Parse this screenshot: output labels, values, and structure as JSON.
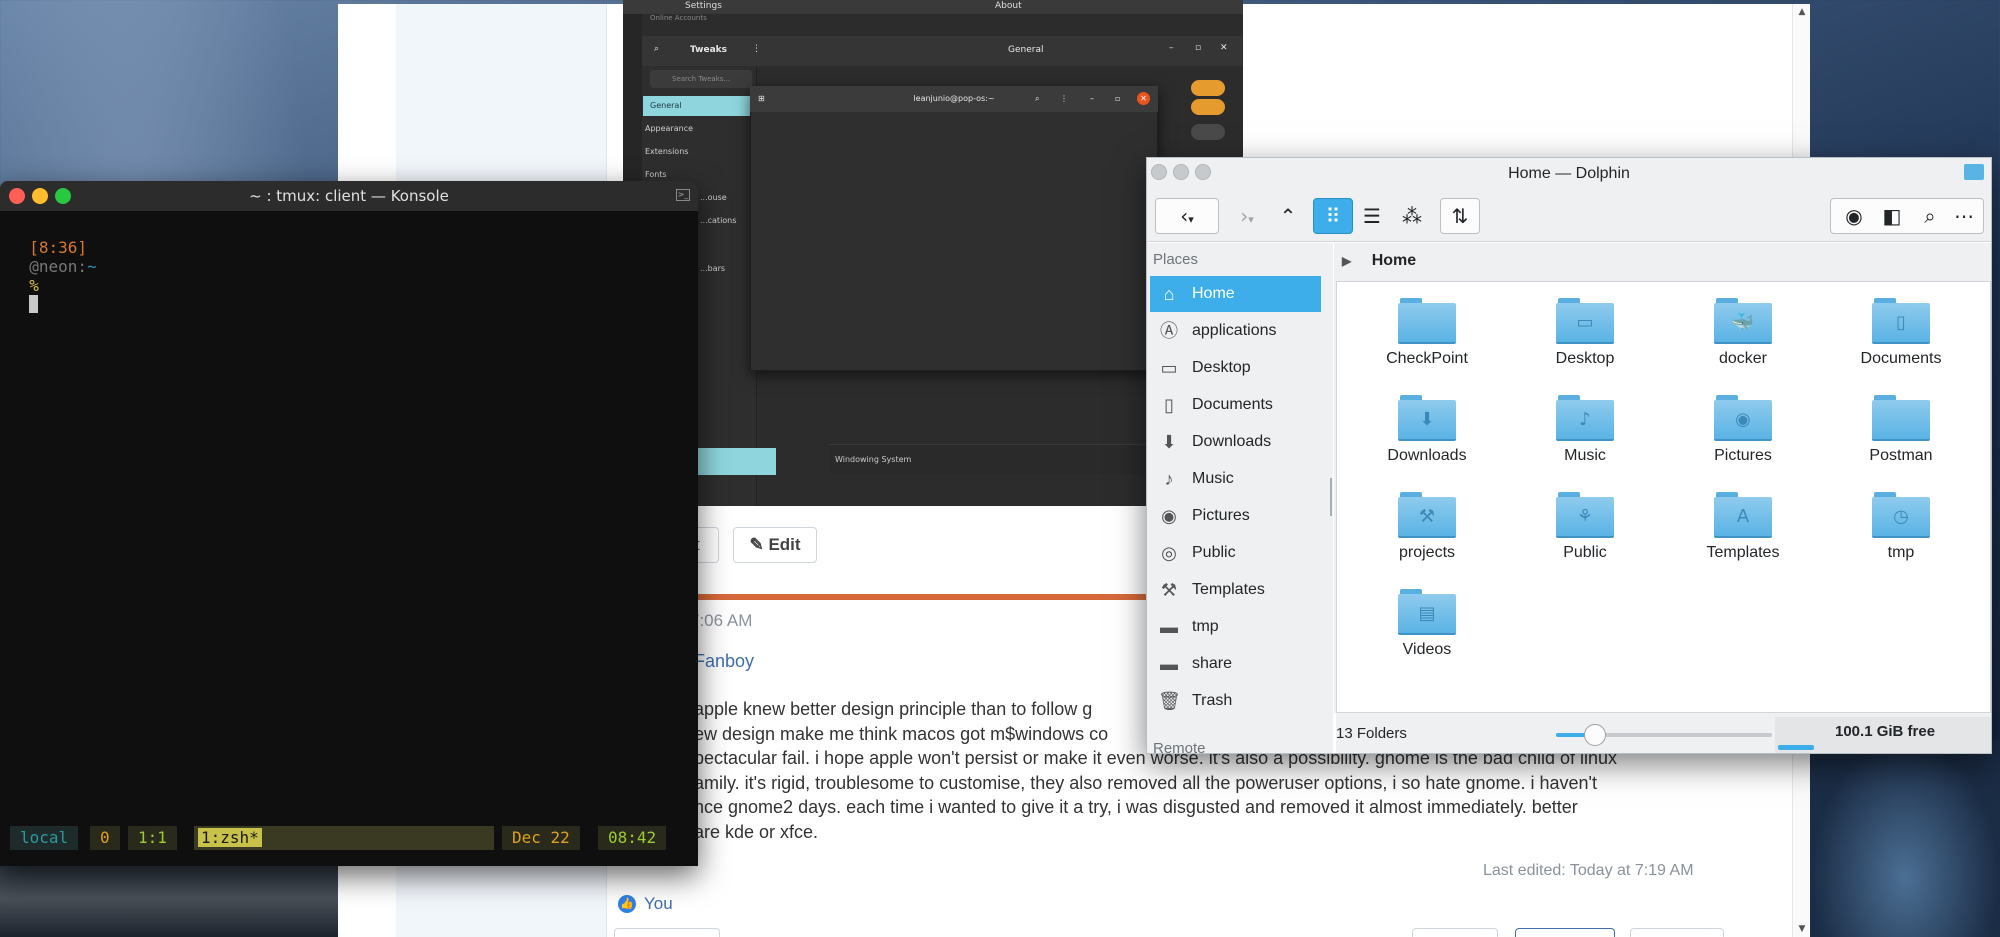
{
  "browser": {
    "post_button_fragment": "t",
    "edit_label": "Edit",
    "edit_icon": "pencil-icon",
    "post_time": "7:06 AM",
    "post_author": "Fanboy",
    "post_lines": [
      "apple knew better design principle than to follow g",
      "ew design make me think macos got m$windows co",
      "pectacular fail. i hope apple won't persist or make it even worse. it's also a possibility. gnome is the bad child of linux",
      "amily. it's rigid, troublesome to customise, they also removed all the poweruser options, i so hate gnome. i haven't",
      "nce gnome2 days. each time i wanted to give it a try, i was disgusted and removed it almost immediately. better",
      "are kde or xfce."
    ],
    "last_edited": "Last edited: Today at 7:19 AM",
    "like_label": "You",
    "like_icon": "thumbs-up-icon"
  },
  "gnome": {
    "settings_title": "Settings",
    "about_title": "About",
    "tweaks_title": "Tweaks",
    "general_title": "General",
    "search_placeholder": "Search Tweaks...",
    "partial_item": "Online Accounts",
    "sidebar_items": [
      "General",
      "Appearance",
      "Extensions",
      "Fonts",
      "...ouse",
      "...cations",
      "...bars"
    ],
    "terminal_title": "leanjunio@pop-os:~",
    "windowing_system": "Windowing System"
  },
  "konsole": {
    "title": "~ : tmux: client — Konsole",
    "prompt_time": "[8:36]",
    "prompt_host": "@neon:",
    "prompt_path": "~",
    "prompt_symbol": "%",
    "status": {
      "session": "local",
      "index": "0",
      "pane": "1:1",
      "window": "1:zsh*",
      "date": "Dec 22",
      "time": "08:42"
    },
    "colors": {
      "time": "#d9782b",
      "host": "#777777",
      "path": "#2b8fb5",
      "symbol": "#e0c050",
      "status_session": "#2a9aa0",
      "status_green": "#9acd32",
      "status_date": "#e0a020"
    }
  },
  "dolphin": {
    "title": "Home — Dolphin",
    "toolbar": {
      "back_icon": "back-arrow-icon",
      "forward_icon": "forward-arrow-icon",
      "up_icon": "up-arrow-icon",
      "icons_view": "icons-view-icon",
      "details_view": "details-view-icon",
      "tree_view": "tree-view-icon",
      "sort_icon": "sort-icon",
      "preview_icon": "eye-icon",
      "split_icon": "split-view-icon",
      "search_icon": "search-icon",
      "menu_icon": "more-icon"
    },
    "places_header": "Places",
    "places": [
      {
        "label": "Home",
        "icon": "home-icon",
        "glyph": "⌂"
      },
      {
        "label": "applications",
        "icon": "applications-icon",
        "glyph": "Ⓐ"
      },
      {
        "label": "Desktop",
        "icon": "desktop-icon",
        "glyph": "▭"
      },
      {
        "label": "Documents",
        "icon": "documents-icon",
        "glyph": "▯"
      },
      {
        "label": "Downloads",
        "icon": "downloads-icon",
        "glyph": "⬇"
      },
      {
        "label": "Music",
        "icon": "music-icon",
        "glyph": "♪"
      },
      {
        "label": "Pictures",
        "icon": "pictures-icon",
        "glyph": "◉"
      },
      {
        "label": "Public",
        "icon": "public-icon",
        "glyph": "◎"
      },
      {
        "label": "Templates",
        "icon": "templates-icon",
        "glyph": "⚒"
      },
      {
        "label": "tmp",
        "icon": "tmp-folder-icon",
        "glyph": "▬"
      },
      {
        "label": "share",
        "icon": "share-folder-icon",
        "glyph": "▬"
      },
      {
        "label": "Trash",
        "icon": "trash-icon",
        "glyph": "🗑"
      }
    ],
    "places_remote": "Remote",
    "breadcrumb": "Home",
    "folders": [
      {
        "label": "CheckPoint",
        "glyph": ""
      },
      {
        "label": "Desktop",
        "glyph": "▭"
      },
      {
        "label": "docker",
        "glyph": "🐳"
      },
      {
        "label": "Documents",
        "glyph": "▯"
      },
      {
        "label": "Downloads",
        "glyph": "⬇"
      },
      {
        "label": "Music",
        "glyph": "♪"
      },
      {
        "label": "Pictures",
        "glyph": "◉"
      },
      {
        "label": "Postman",
        "glyph": ""
      },
      {
        "label": "projects",
        "glyph": "⚒"
      },
      {
        "label": "Public",
        "glyph": "⚘"
      },
      {
        "label": "Templates",
        "glyph": "A"
      },
      {
        "label": "tmp",
        "glyph": "◷"
      },
      {
        "label": "Videos",
        "glyph": "▤"
      }
    ],
    "status_count": "13 Folders",
    "free_space": "100.1 GiB free",
    "zoom_level_fraction": 0.18,
    "disk_used_fraction": 0.17,
    "accent": "#3daee9"
  }
}
